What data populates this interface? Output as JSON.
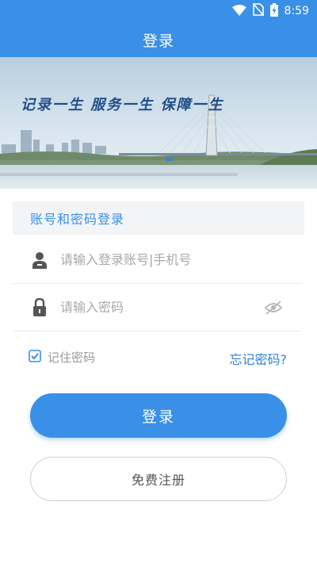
{
  "status_bar": {
    "time": "8:59",
    "icons": [
      "wifi-icon",
      "no-sim-icon",
      "battery-charging-icon"
    ]
  },
  "app_bar": {
    "title": "登录"
  },
  "banner": {
    "slogan": "记录一生 服务一生 保障一生"
  },
  "form": {
    "header_label": "账号和密码登录",
    "account": {
      "placeholder": "请输入登录账号|手机号",
      "value": "",
      "icon": "user-icon"
    },
    "password": {
      "placeholder": "请输入密码",
      "value": "",
      "icon": "lock-icon",
      "toggle_icon": "eye-off-icon"
    },
    "remember": {
      "label": "记住密码",
      "checked": true
    },
    "forgot_label": "忘记密码?",
    "login_label": "登录",
    "register_label": "免费注册"
  },
  "colors": {
    "primary": "#3a8fe6",
    "link": "#2f82d6",
    "placeholder": "#a8a8a8"
  }
}
